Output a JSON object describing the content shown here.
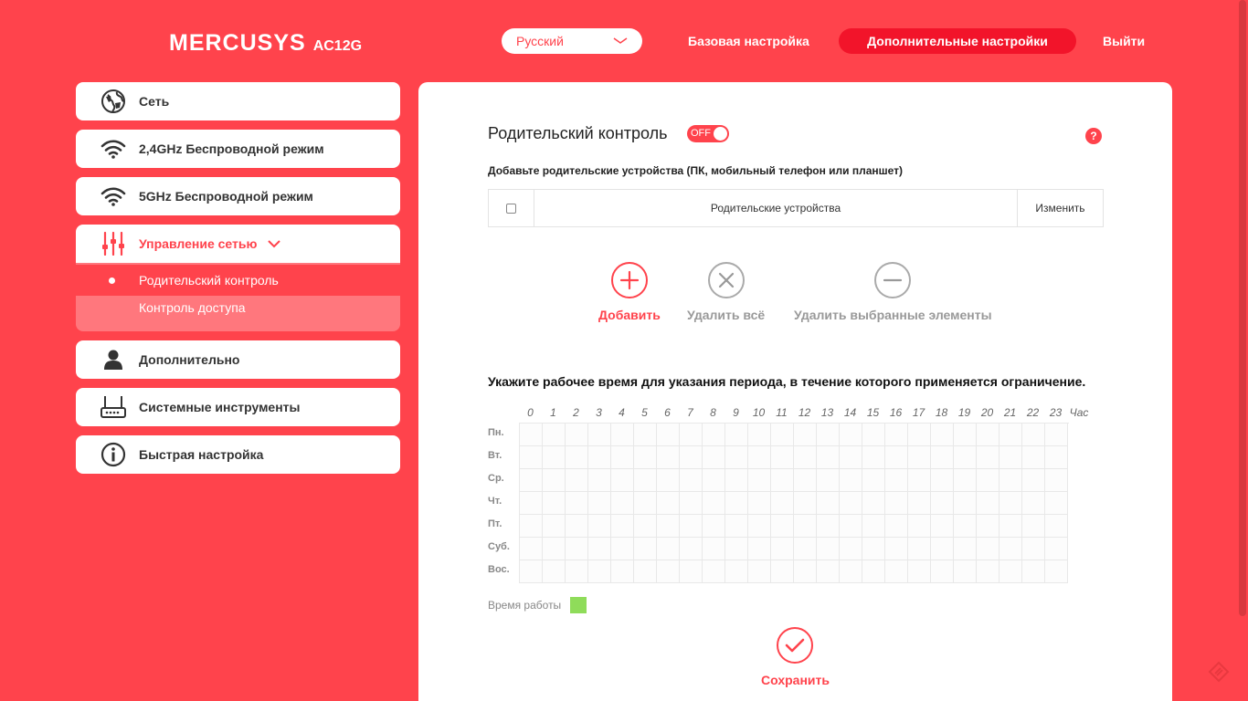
{
  "header": {
    "brand": "MERCUSYS",
    "model": "AC12G",
    "language": "Русский",
    "nav_basic": "Базовая настройка",
    "nav_advanced": "Дополнительные настройки",
    "nav_exit": "Выйти"
  },
  "sidebar": {
    "items": [
      {
        "label": "Сеть",
        "icon": "globe-icon"
      },
      {
        "label": "2,4GHz Беспроводной режим",
        "icon": "wifi-icon"
      },
      {
        "label": "5GHz Беспроводной режим",
        "icon": "wifi-icon"
      },
      {
        "label": "Управление сетью",
        "icon": "sliders-icon"
      },
      {
        "label": "Дополнительно",
        "icon": "user-icon"
      },
      {
        "label": "Системные инструменты",
        "icon": "router-icon"
      },
      {
        "label": "Быстрая настройка",
        "icon": "info-icon"
      }
    ],
    "submenu": [
      "Родительский контроль",
      "Контроль доступа"
    ]
  },
  "main": {
    "title": "Родительский контроль",
    "toggle": "OFF",
    "help": "?",
    "subtitle": "Добавьте родительские устройства (ПК, мобильный телефон или планшет)",
    "table": {
      "col_devices": "Родительские устройства",
      "col_edit": "Изменить"
    },
    "actions": {
      "add": "Добавить",
      "delete_all": "Удалить всё",
      "delete_selected": "Удалить выбранные элементы"
    },
    "schedule_title": "Укажите рабочее время для указания периода, в течение которого применяется ограничение.",
    "hours": [
      "0",
      "1",
      "2",
      "3",
      "4",
      "5",
      "6",
      "7",
      "8",
      "9",
      "10",
      "11",
      "12",
      "13",
      "14",
      "15",
      "16",
      "17",
      "18",
      "19",
      "20",
      "21",
      "22",
      "23"
    ],
    "hours_unit": "Час",
    "days": [
      "Пн.",
      "Вт.",
      "Ср.",
      "Чт.",
      "Пт.",
      "Суб.",
      "Вос."
    ],
    "legend": "Время работы",
    "save": "Сохранить"
  },
  "colors": {
    "accent": "#ff434c",
    "legend_swatch": "#8fdc5a"
  }
}
